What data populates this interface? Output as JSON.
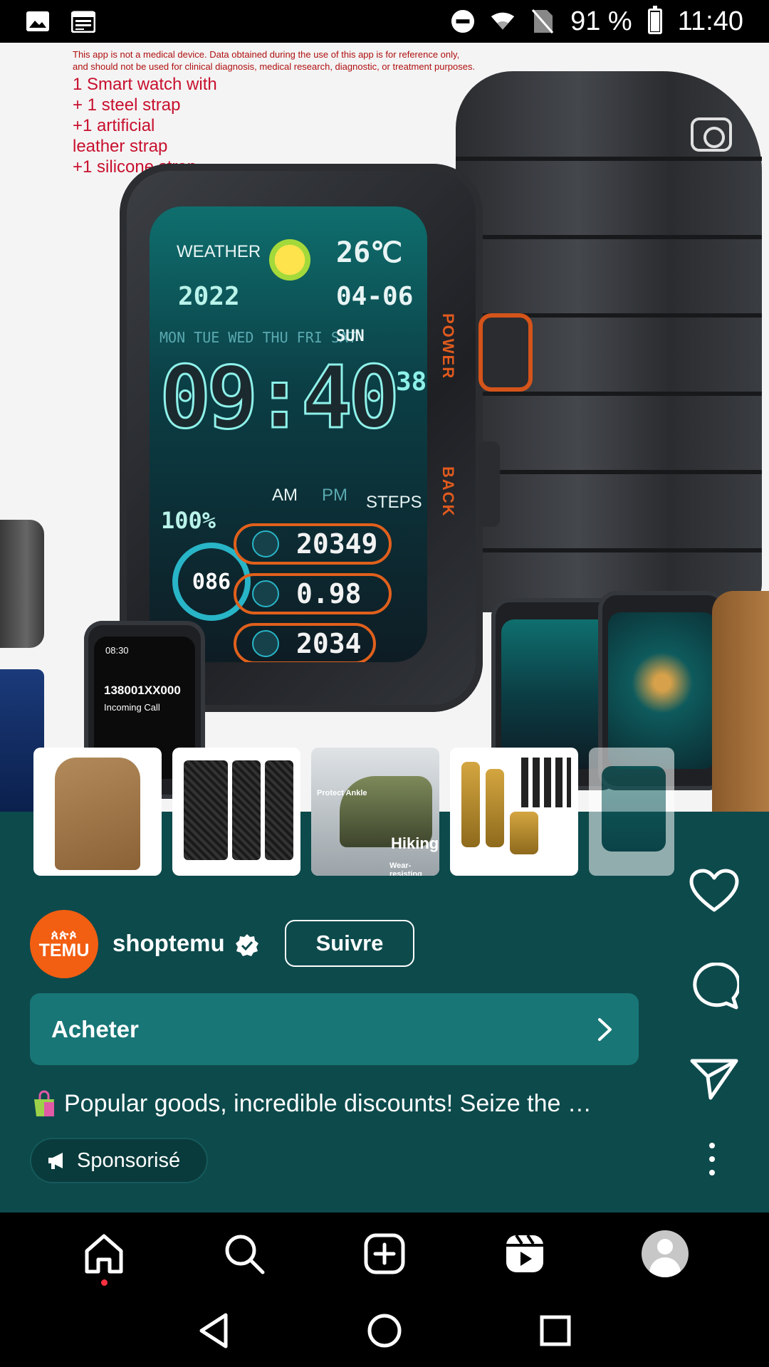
{
  "status_bar": {
    "battery": "91 %",
    "time": "11:40",
    "battery_level": 0.91,
    "icons_left": [
      "image-icon",
      "calendar-icon"
    ],
    "icons_right": [
      "do-not-disturb-icon",
      "wifi-icon",
      "no-sim-icon",
      "battery-icon"
    ]
  },
  "product_image": {
    "disclaimer_line1": "This app is not a medical device. Data obtained during the use of this app is for reference only,",
    "disclaimer_line2": "and should not be used for clinical diagnosis,   medical research, diagnostic, or treatment purposes.",
    "bundle_lines": [
      "1 Smart watch with",
      "+ 1 steel strap",
      "+1 artificial",
      "leather strap",
      "+1 silicone strap"
    ],
    "watch_screen": {
      "weather_label": "WEATHER",
      "temperature": "26℃",
      "year": "2022",
      "date": "04-06",
      "weekdays": "MON TUE WED THU FRI SAT",
      "weekday_active": "SUN",
      "time": "09:40",
      "seconds": "38",
      "am": "AM",
      "pm": "PM",
      "steps_label": "STEPS",
      "battery": "100%",
      "steps": "20349",
      "distance": "0.98",
      "calories": "2034",
      "heart_rate": "086"
    },
    "side_labels": {
      "power": "POWER",
      "back": "BACK"
    },
    "call_watch": {
      "time": "08:30",
      "number": "138001XX000",
      "status": "Incoming Call"
    }
  },
  "thumbnails": [
    {
      "name": "jacket"
    },
    {
      "name": "carbon-wallet"
    },
    {
      "name": "hiking-boot",
      "labels": [
        "Protect Ankle",
        "Hiking",
        "Wear-resisting"
      ]
    },
    {
      "name": "hair-clipper-set"
    },
    {
      "name": "smart-watch"
    }
  ],
  "post": {
    "username": "shoptemu",
    "avatar_glyphs": "ጰጵጶ",
    "avatar_word": "TEMU",
    "follow_label": "Suivre",
    "buy_label": "Acheter",
    "caption": "Popular goods, incredible discounts! Seize the …",
    "sponsored_label": "Sponsorisé"
  },
  "actions": [
    "like-heart-icon",
    "comment-icon",
    "share-send-icon",
    "more-options-icon"
  ],
  "bottom_nav": [
    "home-icon",
    "search-icon",
    "create-post-icon",
    "reels-icon",
    "profile-avatar"
  ],
  "system_nav": [
    "back-icon",
    "home-circle-icon",
    "recents-icon"
  ],
  "colors": {
    "post_background": "#0d4a4c",
    "buy_bar": "#197677",
    "temu_orange": "#f25e12",
    "watch_accent": "#e0601c"
  }
}
